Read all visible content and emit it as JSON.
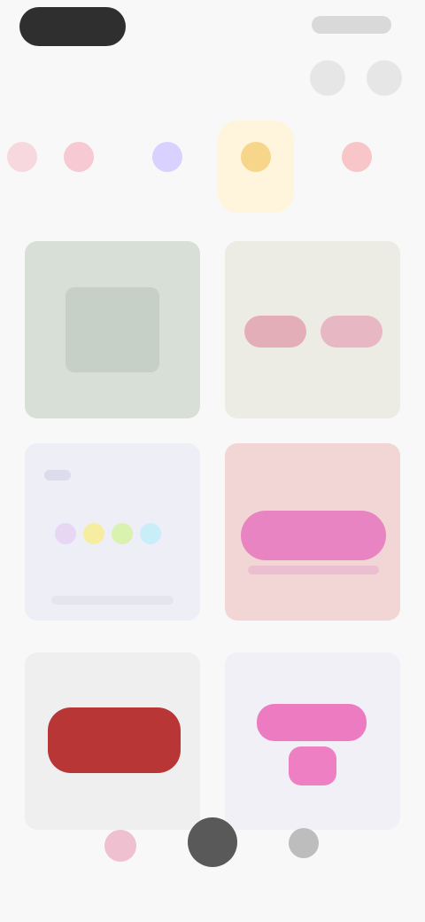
{
  "app": {
    "title": ""
  },
  "header": {
    "title": "",
    "icons": [
      "search-icon",
      "menu-icon"
    ]
  },
  "categories": [
    {
      "label": "",
      "color": "#f7d8df"
    },
    {
      "label": "",
      "color": "#f6c9d3"
    },
    {
      "label": "",
      "color": "#d9d1ff"
    },
    {
      "label": "",
      "color": "#f7d58a"
    },
    {
      "label": "",
      "color": "#f8c5c9"
    }
  ],
  "cards": [
    {
      "title": "",
      "color": "#d8dfd6"
    },
    {
      "title": "",
      "color": "#ecece4"
    },
    {
      "title": "",
      "color": "#eeeef6"
    },
    {
      "title": "",
      "color": "#f2d6d6"
    },
    {
      "title": "",
      "color": "#efefef"
    },
    {
      "title": "",
      "color": "#f1f0f7"
    }
  ],
  "palette": {
    "pink": "#e884c2",
    "red": "#b93636",
    "lavender": "#d9d1ff",
    "yellow": "#f7d58a"
  },
  "bottom_nav": {
    "left": "heart-icon",
    "center": "home-icon",
    "right": "profile-icon"
  }
}
